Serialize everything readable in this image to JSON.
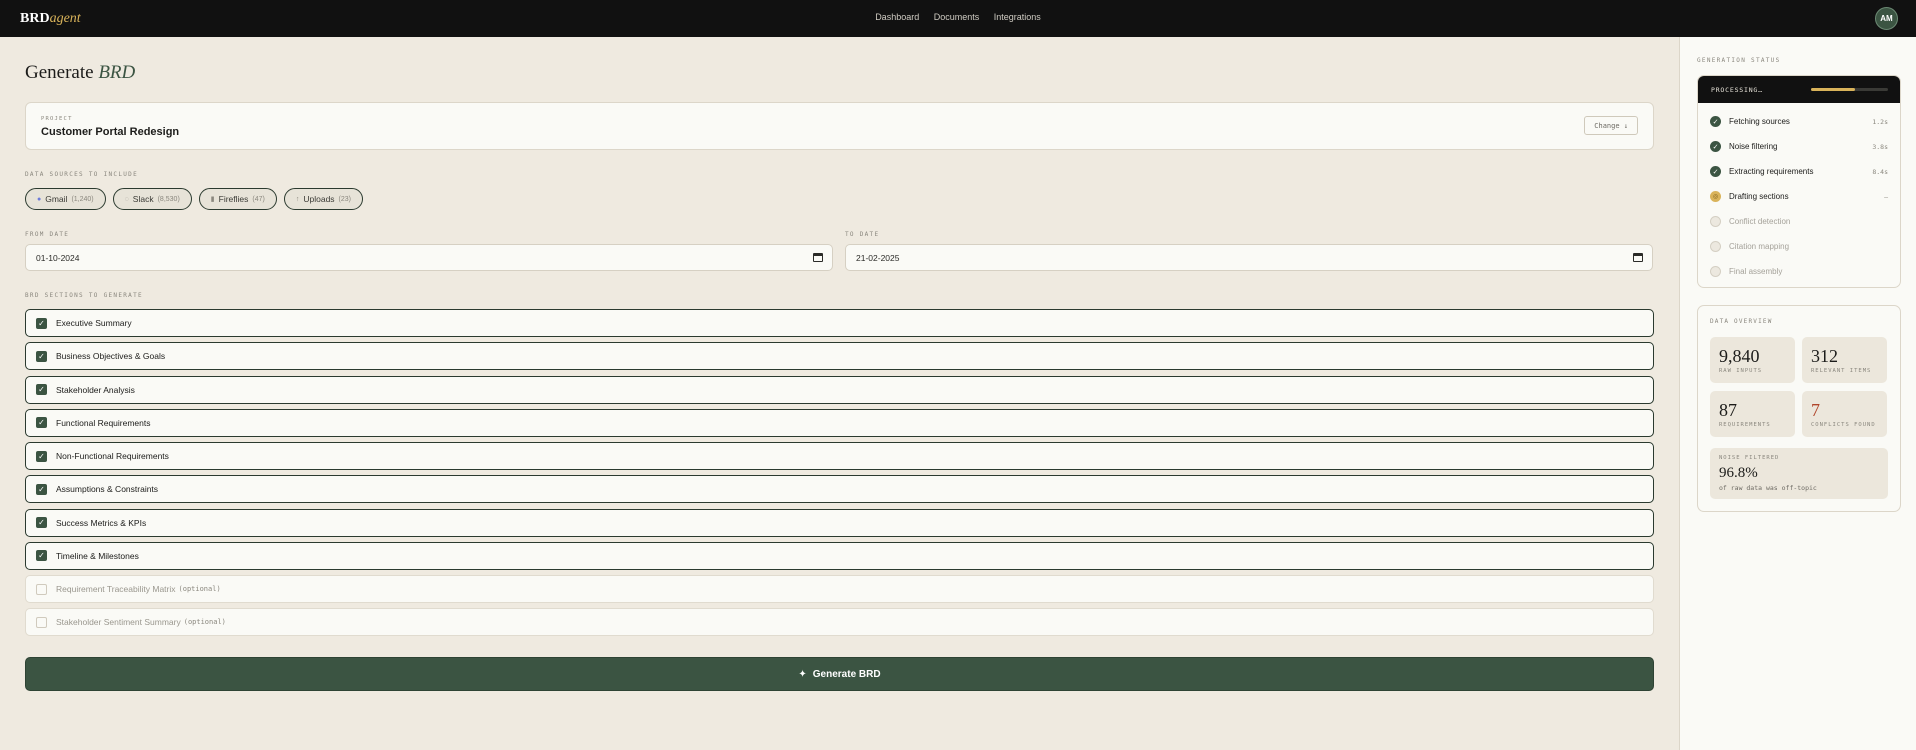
{
  "brand": {
    "part1": "BRD",
    "part2": "agent"
  },
  "nav": {
    "items": [
      "Dashboard",
      "Documents",
      "Integrations"
    ]
  },
  "user": {
    "initials": "AM"
  },
  "page": {
    "title_main": "Generate",
    "title_accent": "BRD"
  },
  "project": {
    "label": "PROJECT",
    "name": "Customer Portal Redesign",
    "change_label": "Change ↓"
  },
  "sources": {
    "label": "DATA SOURCES TO INCLUDE",
    "items": [
      {
        "icon": "●",
        "name": "Gmail",
        "count": "(1,240)"
      },
      {
        "icon": "◌",
        "name": "Slack",
        "count": "(8,530)"
      },
      {
        "icon": "▮",
        "name": "Fireflies",
        "count": "(47)"
      },
      {
        "icon": "↑",
        "name": "Uploads",
        "count": "(23)"
      }
    ]
  },
  "dates": {
    "from_label": "FROM DATE",
    "from_value": "01-10-2024",
    "to_label": "TO DATE",
    "to_value": "21-02-2025"
  },
  "sections": {
    "label": "BRD SECTIONS TO GENERATE",
    "items": [
      {
        "name": "Executive Summary",
        "optional": ""
      },
      {
        "name": "Business Objectives & Goals",
        "optional": ""
      },
      {
        "name": "Stakeholder Analysis",
        "optional": ""
      },
      {
        "name": "Functional Requirements",
        "optional": ""
      },
      {
        "name": "Non-Functional Requirements",
        "optional": ""
      },
      {
        "name": "Assumptions & Constraints",
        "optional": ""
      },
      {
        "name": "Success Metrics & KPIs",
        "optional": ""
      },
      {
        "name": "Timeline & Milestones",
        "optional": ""
      },
      {
        "name": "Requirement Traceability Matrix",
        "optional": "(optional)"
      },
      {
        "name": "Stakeholder Sentiment Summary",
        "optional": "(optional)"
      }
    ]
  },
  "generate_button": {
    "icon": "✦",
    "label": "Generate BRD"
  },
  "status": {
    "label": "GENERATION STATUS",
    "header": "PROCESSING…",
    "progress": 0.57,
    "steps": [
      {
        "name": "Fetching sources",
        "time": "1.2s",
        "state": "done"
      },
      {
        "name": "Noise filtering",
        "time": "3.8s",
        "state": "done"
      },
      {
        "name": "Extracting requirements",
        "time": "8.4s",
        "state": "done"
      },
      {
        "name": "Drafting sections",
        "time": "—",
        "state": "active"
      },
      {
        "name": "Conflict detection",
        "time": "",
        "state": "pending"
      },
      {
        "name": "Citation mapping",
        "time": "",
        "state": "pending"
      },
      {
        "name": "Final assembly",
        "time": "",
        "state": "pending"
      }
    ]
  },
  "overview": {
    "label": "DATA OVERVIEW",
    "raw_inputs": {
      "value": "9,840",
      "label": "RAW INPUTS"
    },
    "relevant_items": {
      "value": "312",
      "label": "RELEVANT ITEMS"
    },
    "requirements": {
      "value": "87",
      "label": "REQUIREMENTS"
    },
    "conflicts": {
      "value": "7",
      "label": "CONFLICTS FOUND"
    },
    "noise": {
      "label": "NOISE FILTERED",
      "value": "96.8%",
      "sub": "of raw data was off-topic"
    }
  },
  "colors": {
    "accent": "#3b5442",
    "gold": "#d9b35a",
    "conflict": "#b0452a"
  }
}
